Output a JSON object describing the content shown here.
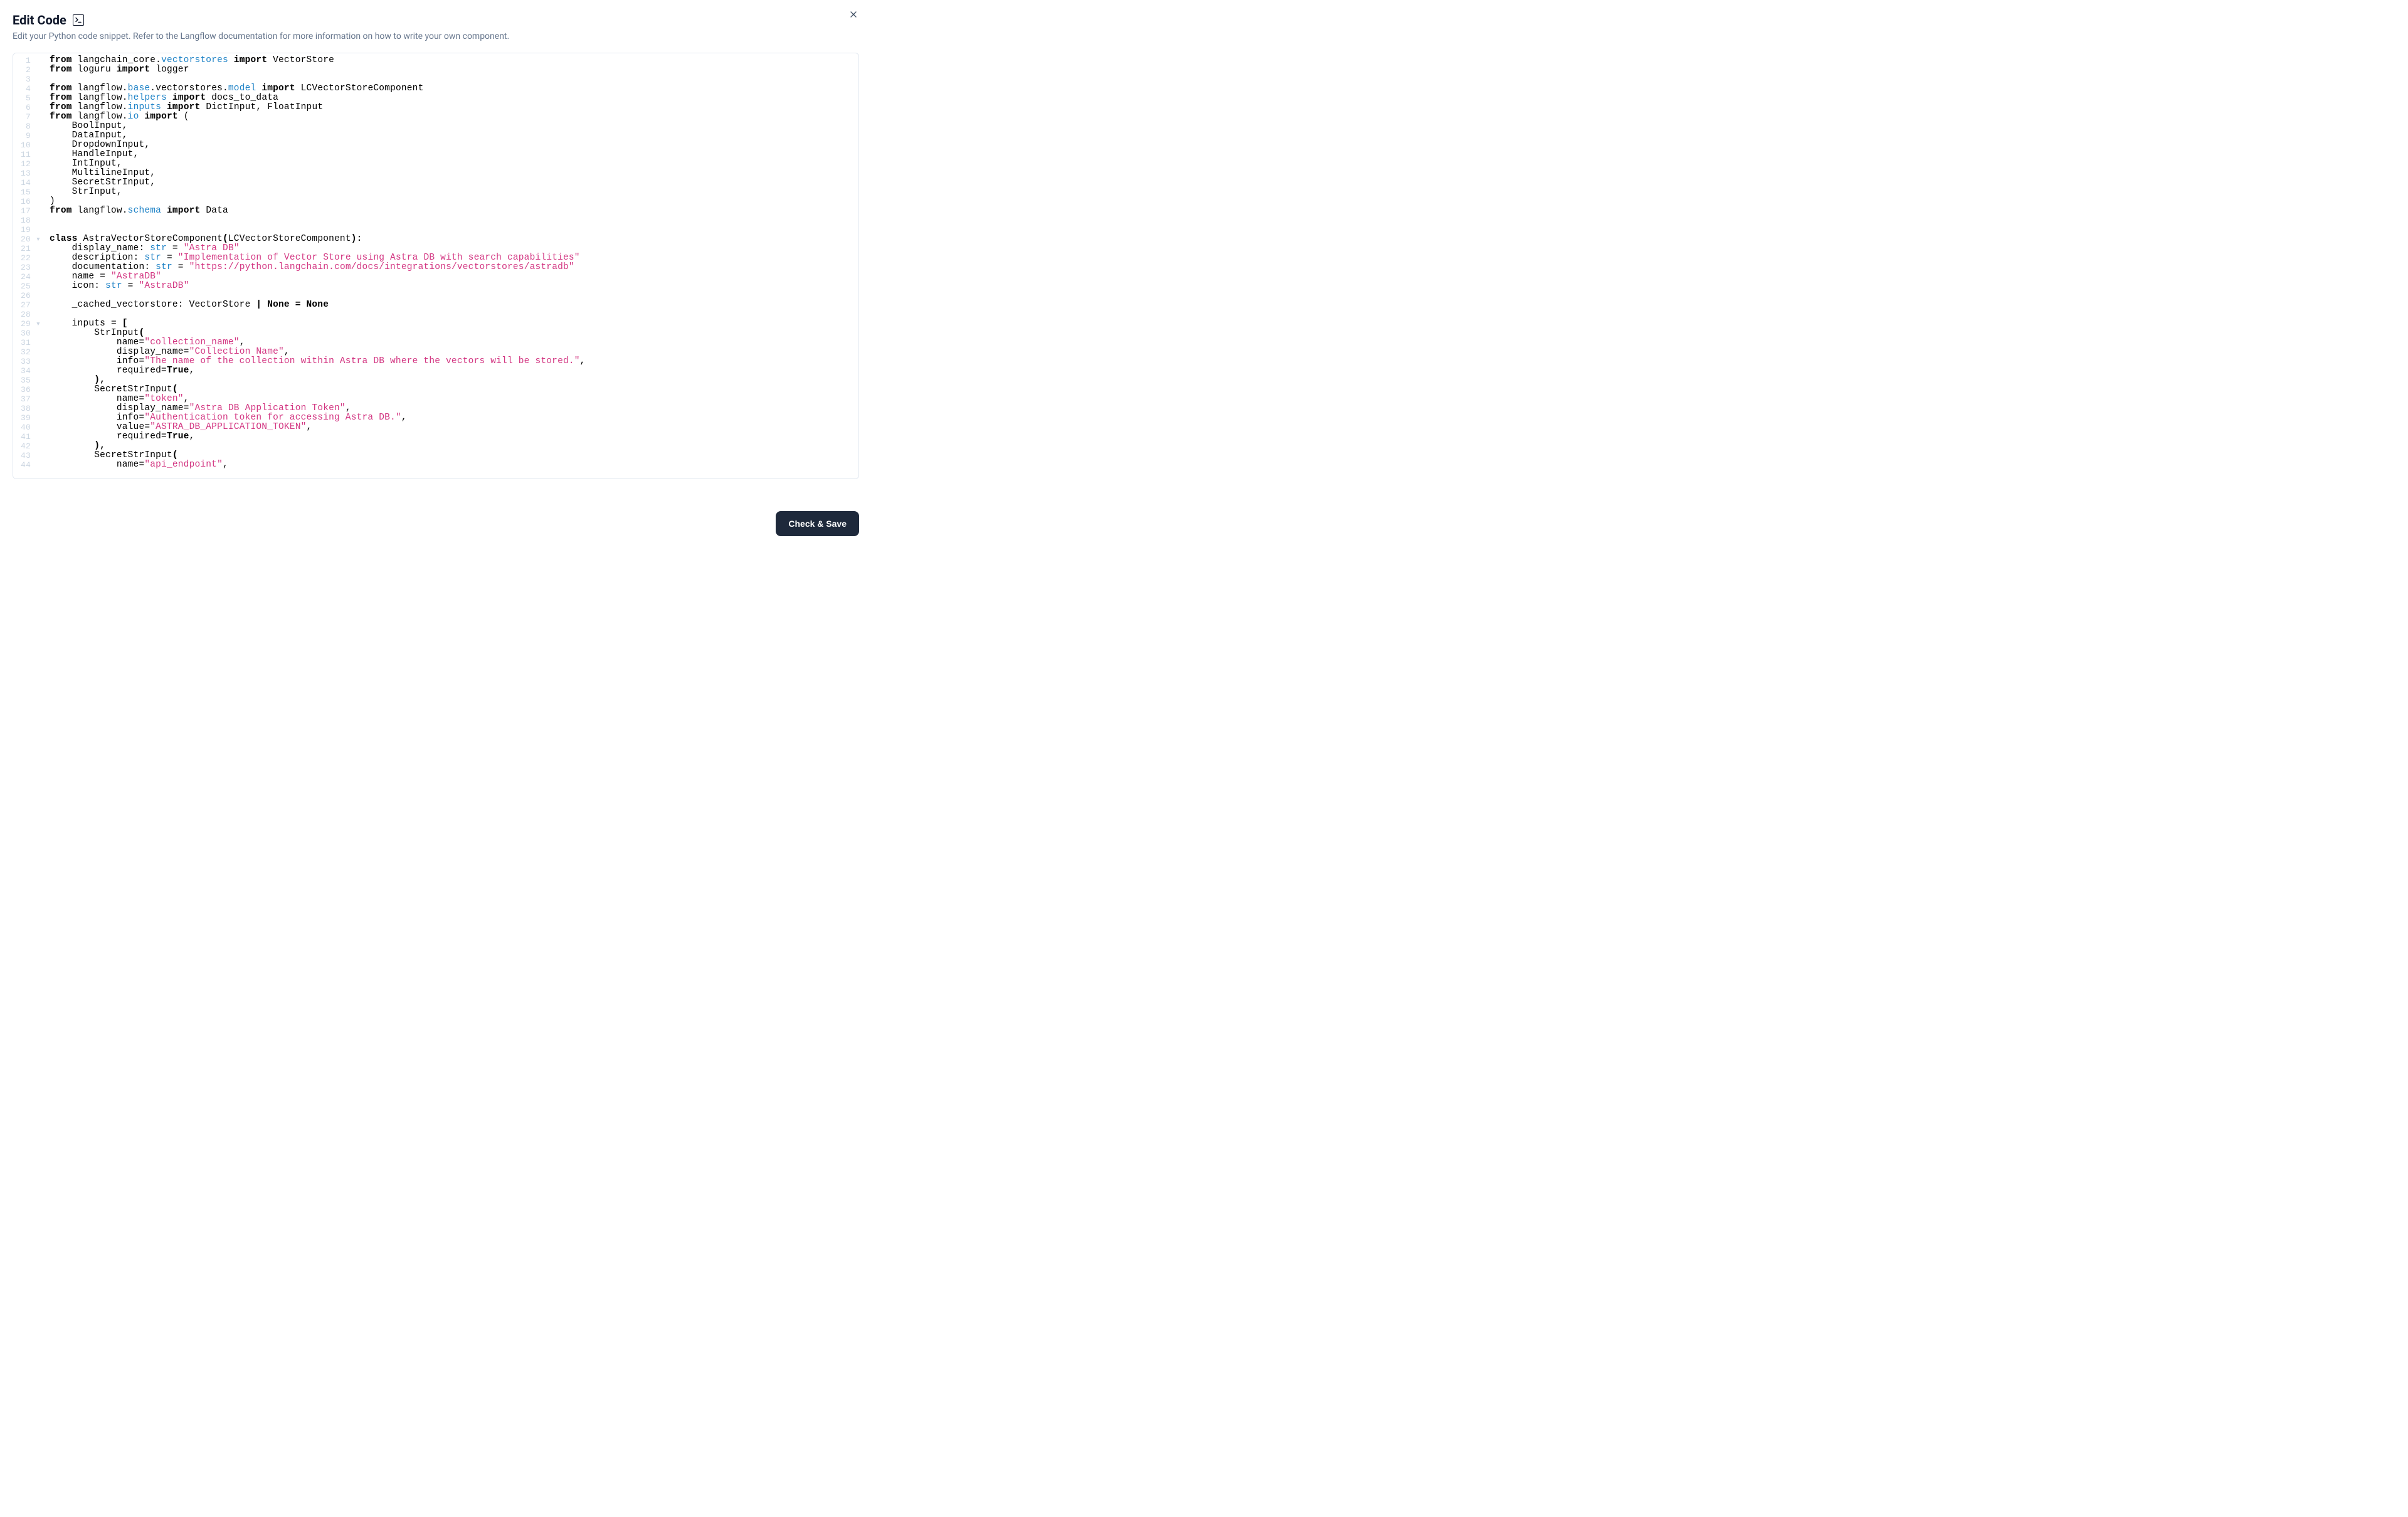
{
  "header": {
    "title": "Edit Code",
    "description": "Edit your Python code snippet. Refer to the Langflow documentation for more information on how to write your own component."
  },
  "footer": {
    "save_label": "Check & Save"
  },
  "editor": {
    "line_count": 44,
    "fold_markers": {
      "20": true,
      "29": true
    }
  },
  "code": {
    "lines": [
      [
        {
          "t": "from ",
          "c": "kw"
        },
        {
          "t": "langchain_core."
        },
        {
          "t": "vectorstores",
          "c": "blue"
        },
        {
          "t": " import ",
          "c": "kw"
        },
        {
          "t": "VectorStore"
        }
      ],
      [
        {
          "t": "from ",
          "c": "kw"
        },
        {
          "t": "loguru"
        },
        {
          "t": " import ",
          "c": "kw"
        },
        {
          "t": "logger"
        }
      ],
      [],
      [
        {
          "t": "from ",
          "c": "kw"
        },
        {
          "t": "langflow."
        },
        {
          "t": "base",
          "c": "blue"
        },
        {
          "t": ".vectorstores."
        },
        {
          "t": "model",
          "c": "blue"
        },
        {
          "t": " import ",
          "c": "kw"
        },
        {
          "t": "LCVectorStoreComponent"
        }
      ],
      [
        {
          "t": "from ",
          "c": "kw"
        },
        {
          "t": "langflow."
        },
        {
          "t": "helpers",
          "c": "blue"
        },
        {
          "t": " import ",
          "c": "kw"
        },
        {
          "t": "docs_to_data"
        }
      ],
      [
        {
          "t": "from ",
          "c": "kw"
        },
        {
          "t": "langflow."
        },
        {
          "t": "inputs",
          "c": "blue"
        },
        {
          "t": " import ",
          "c": "kw"
        },
        {
          "t": "DictInput, FloatInput"
        }
      ],
      [
        {
          "t": "from ",
          "c": "kw"
        },
        {
          "t": "langflow."
        },
        {
          "t": "io",
          "c": "blue"
        },
        {
          "t": " import ",
          "c": "kw"
        },
        {
          "t": "("
        }
      ],
      [
        {
          "t": "    BoolInput,"
        }
      ],
      [
        {
          "t": "    DataInput,"
        }
      ],
      [
        {
          "t": "    DropdownInput,"
        }
      ],
      [
        {
          "t": "    HandleInput,"
        }
      ],
      [
        {
          "t": "    IntInput,"
        }
      ],
      [
        {
          "t": "    MultilineInput,"
        }
      ],
      [
        {
          "t": "    SecretStrInput,"
        }
      ],
      [
        {
          "t": "    StrInput,"
        }
      ],
      [
        {
          "t": ")"
        }
      ],
      [
        {
          "t": "from ",
          "c": "kw"
        },
        {
          "t": "langflow."
        },
        {
          "t": "schema",
          "c": "blue"
        },
        {
          "t": " import ",
          "c": "kw"
        },
        {
          "t": "Data"
        }
      ],
      [],
      [],
      [
        {
          "t": "class ",
          "c": "kw"
        },
        {
          "t": "AstraVectorStoreComponent"
        },
        {
          "t": "(",
          "c": "kw"
        },
        {
          "t": "LCVectorStoreComponent"
        },
        {
          "t": "):",
          "c": "kw"
        }
      ],
      [
        {
          "t": "    display_name: "
        },
        {
          "t": "str",
          "c": "blue"
        },
        {
          "t": " = "
        },
        {
          "t": "\"Astra DB\"",
          "c": "str"
        }
      ],
      [
        {
          "t": "    description: "
        },
        {
          "t": "str",
          "c": "blue"
        },
        {
          "t": " = "
        },
        {
          "t": "\"Implementation of Vector Store using Astra DB with search capabilities\"",
          "c": "str"
        }
      ],
      [
        {
          "t": "    documentation: "
        },
        {
          "t": "str",
          "c": "blue"
        },
        {
          "t": " = "
        },
        {
          "t": "\"https://python.langchain.com/docs/integrations/vectorstores/astradb\"",
          "c": "str"
        }
      ],
      [
        {
          "t": "    name = "
        },
        {
          "t": "\"AstraDB\"",
          "c": "str"
        }
      ],
      [
        {
          "t": "    icon: "
        },
        {
          "t": "str",
          "c": "blue"
        },
        {
          "t": " = "
        },
        {
          "t": "\"AstraDB\"",
          "c": "str"
        }
      ],
      [],
      [
        {
          "t": "    _cached_vectorstore: VectorStore "
        },
        {
          "t": "| None = None",
          "c": "kw"
        }
      ],
      [],
      [
        {
          "t": "    inputs = "
        },
        {
          "t": "[",
          "c": "kw"
        }
      ],
      [
        {
          "t": "        StrInput"
        },
        {
          "t": "(",
          "c": "kw"
        }
      ],
      [
        {
          "t": "            name="
        },
        {
          "t": "\"collection_name\"",
          "c": "str"
        },
        {
          "t": ","
        }
      ],
      [
        {
          "t": "            display_name="
        },
        {
          "t": "\"Collection Name\"",
          "c": "str"
        },
        {
          "t": ","
        }
      ],
      [
        {
          "t": "            info="
        },
        {
          "t": "\"The name of the collection within Astra DB where the vectors will be stored.\"",
          "c": "str"
        },
        {
          "t": ","
        }
      ],
      [
        {
          "t": "            required="
        },
        {
          "t": "True",
          "c": "kw"
        },
        {
          "t": ","
        }
      ],
      [
        {
          "t": "        "
        },
        {
          "t": "),",
          "c": "kw"
        }
      ],
      [
        {
          "t": "        SecretStrInput"
        },
        {
          "t": "(",
          "c": "kw"
        }
      ],
      [
        {
          "t": "            name="
        },
        {
          "t": "\"token\"",
          "c": "str"
        },
        {
          "t": ","
        }
      ],
      [
        {
          "t": "            display_name="
        },
        {
          "t": "\"Astra DB Application Token\"",
          "c": "str"
        },
        {
          "t": ","
        }
      ],
      [
        {
          "t": "            info="
        },
        {
          "t": "\"Authentication token for accessing Astra DB.\"",
          "c": "str"
        },
        {
          "t": ","
        }
      ],
      [
        {
          "t": "            value="
        },
        {
          "t": "\"ASTRA_DB_APPLICATION_TOKEN\"",
          "c": "str"
        },
        {
          "t": ","
        }
      ],
      [
        {
          "t": "            required="
        },
        {
          "t": "True",
          "c": "kw"
        },
        {
          "t": ","
        }
      ],
      [
        {
          "t": "        "
        },
        {
          "t": "),",
          "c": "kw"
        }
      ],
      [
        {
          "t": "        SecretStrInput"
        },
        {
          "t": "(",
          "c": "kw"
        }
      ],
      [
        {
          "t": "            name="
        },
        {
          "t": "\"api_endpoint\"",
          "c": "str"
        },
        {
          "t": ","
        }
      ]
    ]
  }
}
